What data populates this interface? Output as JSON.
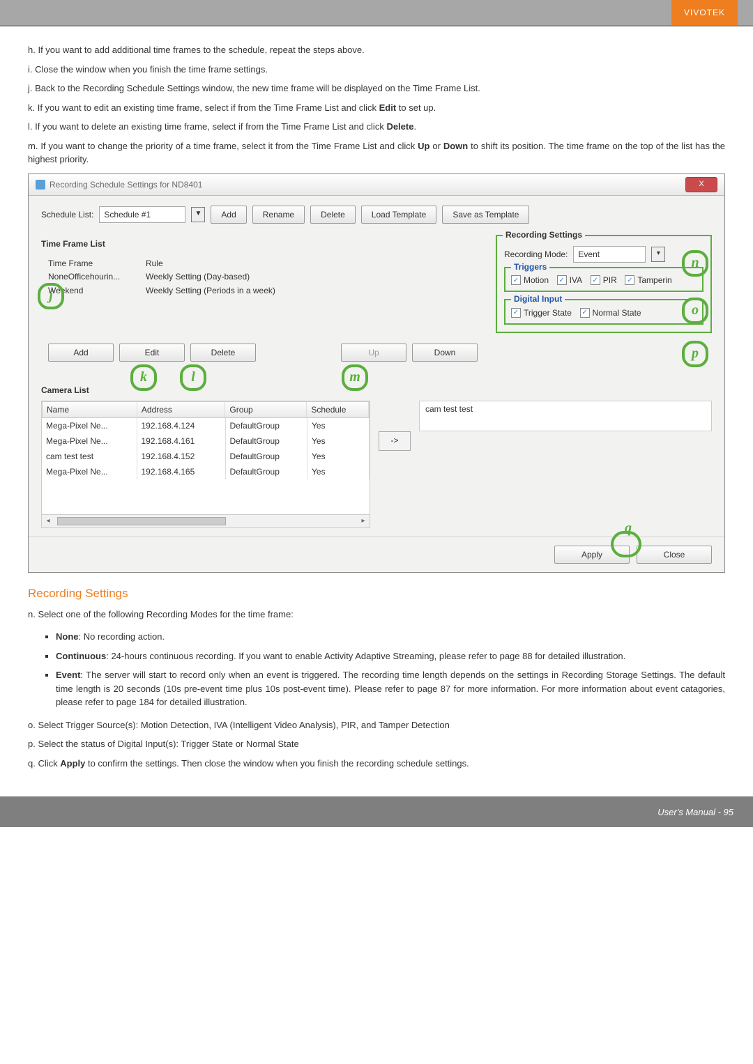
{
  "brand": "VIVOTEK",
  "steps_top": {
    "h": "h. If you want to add additional time frames to the schedule, repeat the steps above.",
    "i": "i. Close the window when you finish the time frame settings.",
    "j": "j. Back to the Recording Schedule Settings window, the new time frame will be displayed on the Time Frame List.",
    "k_pre": "k. If you want to edit an existing time frame, select if from the Time Frame List and click ",
    "k_bold": "Edit",
    "k_post": " to set up.",
    "l_pre": "l. If you want to delete an existing time frame, select if from the Time Frame List and click ",
    "l_bold": "Delete",
    "l_post": ".",
    "m_pre": "m. If you want to change the priority of a time frame, select it from the Time Frame List and click ",
    "m_b1": "Up",
    "m_mid": " or ",
    "m_b2": "Down",
    "m_post": " to shift its position. The time frame on the top of the list has the highest priority."
  },
  "window": {
    "title": "Recording Schedule Settings for ND8401",
    "close_x": "X",
    "schedule_list_label": "Schedule List:",
    "schedule_selected": "Schedule #1",
    "btn_add": "Add",
    "btn_rename": "Rename",
    "btn_delete": "Delete",
    "btn_load": "Load Template",
    "btn_save": "Save as Template",
    "time_frame_list": "Time Frame List",
    "col_tf": "Time Frame",
    "col_rule": "Rule",
    "rows": [
      {
        "tf": "NoneOfficehourin...",
        "rule": "Weekly Setting (Day-based)"
      },
      {
        "tf": "Weekend",
        "rule": "Weekly Setting (Periods in a week)"
      }
    ],
    "tf_add": "Add",
    "tf_edit": "Edit",
    "tf_delete": "Delete",
    "tf_up": "Up",
    "tf_down": "Down",
    "rec_settings": "Recording Settings",
    "rec_mode_label": "Recording Mode:",
    "rec_mode_value": "Event",
    "triggers_title": "Triggers",
    "trg_motion": "Motion",
    "trg_iva": "IVA",
    "trg_pir": "PIR",
    "trg_tamper": "Tamperin",
    "di_title": "Digital Input",
    "di_trigger": "Trigger State",
    "di_normal": "Normal State",
    "camera_list": "Camera List",
    "cam_cols": {
      "c1": "Name",
      "c2": "Address",
      "c3": "Group",
      "c4": "Schedule"
    },
    "cams": [
      {
        "n": "Mega-Pixel Ne...",
        "a": "192.168.4.124",
        "g": "DefaultGroup",
        "s": "Yes"
      },
      {
        "n": "Mega-Pixel Ne...",
        "a": "192.168.4.161",
        "g": "DefaultGroup",
        "s": "Yes"
      },
      {
        "n": "cam test test",
        "a": "192.168.4.152",
        "g": "DefaultGroup",
        "s": "Yes"
      },
      {
        "n": "Mega-Pixel Ne...",
        "a": "192.168.4.165",
        "g": "DefaultGroup",
        "s": "Yes"
      }
    ],
    "cam_target": "cam test test",
    "move_arrow": "->",
    "apply": "Apply",
    "close": "Close"
  },
  "markers": {
    "j": "j",
    "k": "k",
    "l": "l",
    "m": "m",
    "n": "n",
    "o": "o",
    "p": "p",
    "q": "q"
  },
  "rec_heading": "Recording Settings",
  "steps_bottom": {
    "n": "n. Select one of the following Recording Modes for the time frame:",
    "b_none_t": "None",
    "b_none": ": No recording action.",
    "b_cont_t": "Continuous",
    "b_cont": ": 24-hours continuous recording. If you want to enable Activity Adaptive Streaming, please refer to page 88 for detailed illustration.",
    "b_event_t": "Event",
    "b_event": ": The server will start to record only when an event is triggered. The recording time length depends on the settings in Recording Storage Settings. The default time length is 20 seconds (10s pre-event time plus 10s post-event time). Please refer to page 87 for more information. For more information about event catagories, please refer to page 184 for detailed illustration.",
    "o": "o. Select Trigger Source(s): Motion Detection, IVA (Intelligent Video Analysis), PIR, and Tamper Detection",
    "p": "p. Select the status of Digital Input(s): Trigger State or Normal State",
    "q_pre": "q. Click ",
    "q_b": "Apply",
    "q_post": " to confirm the settings. Then close the window when you finish the recording schedule settings."
  },
  "footer": "User's Manual - 95"
}
